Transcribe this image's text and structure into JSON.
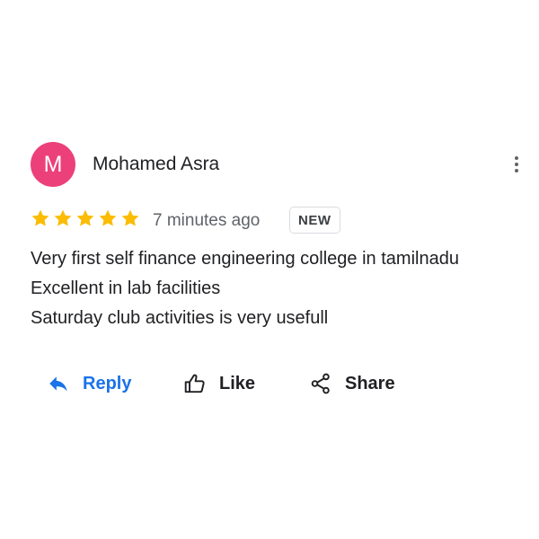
{
  "review": {
    "author": {
      "name": "Mohamed Asra",
      "initial": "M",
      "avatar_color": "#ec407a"
    },
    "rating": 5,
    "max_rating": 5,
    "star_color": "#fbbc04",
    "time_ago": "7 minutes ago",
    "badge": "NEW",
    "text_lines": [
      "Very first self finance engineering college in tamilnadu",
      "Excellent in lab facilities",
      "Saturday club activities is very usefull"
    ]
  },
  "menu": {
    "icon": "more-vert-icon"
  },
  "actions": {
    "reply": {
      "label": "Reply",
      "icon": "reply-icon",
      "color": "#1a73e8"
    },
    "like": {
      "label": "Like",
      "icon": "thumbs-up-icon"
    },
    "share": {
      "label": "Share",
      "icon": "share-icon"
    }
  }
}
